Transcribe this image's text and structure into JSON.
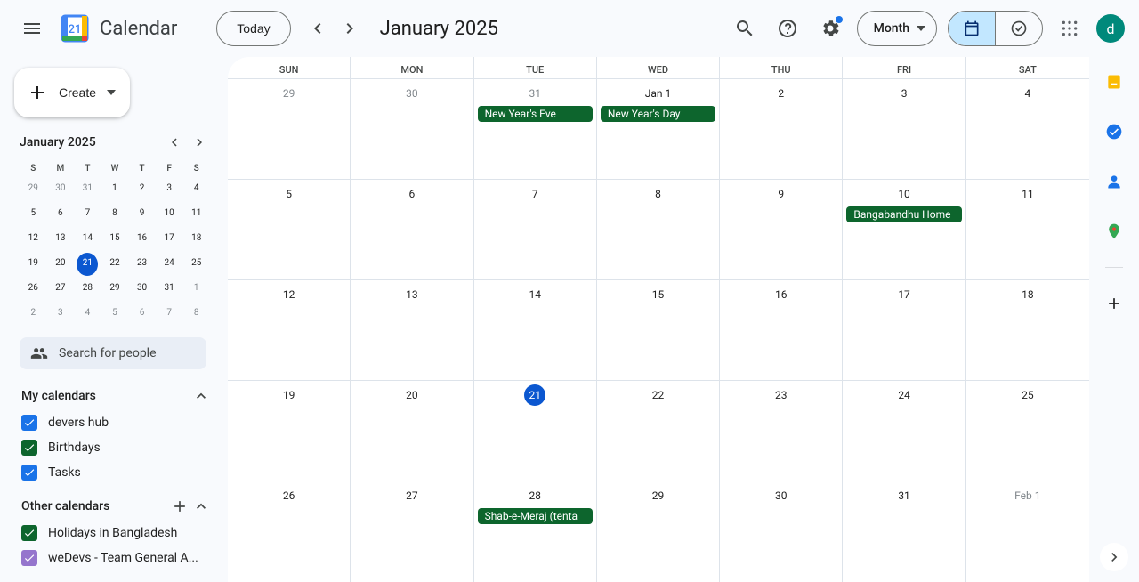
{
  "header": {
    "app_title": "Calendar",
    "today_label": "Today",
    "month_label": "January 2025",
    "view_label": "Month",
    "avatar_letter": "d"
  },
  "sidebar": {
    "create_label": "Create",
    "mini_cal": {
      "month": "January 2025",
      "dow": [
        "S",
        "M",
        "T",
        "W",
        "T",
        "F",
        "S"
      ],
      "days": [
        {
          "n": "29",
          "other": true
        },
        {
          "n": "30",
          "other": true
        },
        {
          "n": "31",
          "other": true
        },
        {
          "n": "1"
        },
        {
          "n": "2"
        },
        {
          "n": "3"
        },
        {
          "n": "4"
        },
        {
          "n": "5"
        },
        {
          "n": "6"
        },
        {
          "n": "7"
        },
        {
          "n": "8"
        },
        {
          "n": "9"
        },
        {
          "n": "10"
        },
        {
          "n": "11"
        },
        {
          "n": "12"
        },
        {
          "n": "13"
        },
        {
          "n": "14"
        },
        {
          "n": "15"
        },
        {
          "n": "16"
        },
        {
          "n": "17"
        },
        {
          "n": "18"
        },
        {
          "n": "19"
        },
        {
          "n": "20"
        },
        {
          "n": "21",
          "today": true
        },
        {
          "n": "22"
        },
        {
          "n": "23"
        },
        {
          "n": "24"
        },
        {
          "n": "25"
        },
        {
          "n": "26"
        },
        {
          "n": "27"
        },
        {
          "n": "28"
        },
        {
          "n": "29"
        },
        {
          "n": "30"
        },
        {
          "n": "31"
        },
        {
          "n": "1",
          "other": true
        },
        {
          "n": "2",
          "other": true
        },
        {
          "n": "3",
          "other": true
        },
        {
          "n": "4",
          "other": true
        },
        {
          "n": "5",
          "other": true
        },
        {
          "n": "6",
          "other": true
        },
        {
          "n": "7",
          "other": true
        },
        {
          "n": "8",
          "other": true
        }
      ]
    },
    "search_placeholder": "Search for people",
    "my_cal_title": "My calendars",
    "my_cals": [
      {
        "label": "devers hub",
        "color": "#1a73e8"
      },
      {
        "label": "Birthdays",
        "color": "#0d652d"
      },
      {
        "label": "Tasks",
        "color": "#1a73e8"
      }
    ],
    "other_cal_title": "Other calendars",
    "other_cals": [
      {
        "label": "Holidays in Bangladesh",
        "color": "#0d652d"
      },
      {
        "label": "weDevs - Team General A...",
        "color": "#9575cd"
      }
    ]
  },
  "grid": {
    "dow": [
      "SUN",
      "MON",
      "TUE",
      "WED",
      "THU",
      "FRI",
      "SAT"
    ],
    "weeks": [
      [
        {
          "num": "29",
          "other": true
        },
        {
          "num": "30",
          "other": true
        },
        {
          "num": "31",
          "other": true,
          "events": [
            "New Year's Eve"
          ]
        },
        {
          "num": "Jan 1",
          "events": [
            "New Year's Day"
          ]
        },
        {
          "num": "2"
        },
        {
          "num": "3"
        },
        {
          "num": "4"
        }
      ],
      [
        {
          "num": "5"
        },
        {
          "num": "6"
        },
        {
          "num": "7"
        },
        {
          "num": "8"
        },
        {
          "num": "9"
        },
        {
          "num": "10",
          "events": [
            "Bangabandhu Home"
          ]
        },
        {
          "num": "11"
        }
      ],
      [
        {
          "num": "12"
        },
        {
          "num": "13"
        },
        {
          "num": "14"
        },
        {
          "num": "15"
        },
        {
          "num": "16"
        },
        {
          "num": "17"
        },
        {
          "num": "18"
        }
      ],
      [
        {
          "num": "19"
        },
        {
          "num": "20"
        },
        {
          "num": "21",
          "today": true
        },
        {
          "num": "22"
        },
        {
          "num": "23"
        },
        {
          "num": "24"
        },
        {
          "num": "25"
        }
      ],
      [
        {
          "num": "26"
        },
        {
          "num": "27"
        },
        {
          "num": "28",
          "events": [
            "Shab-e-Meraj (tenta"
          ]
        },
        {
          "num": "29"
        },
        {
          "num": "30"
        },
        {
          "num": "31"
        },
        {
          "num": "Feb 1",
          "other": true
        }
      ]
    ]
  }
}
